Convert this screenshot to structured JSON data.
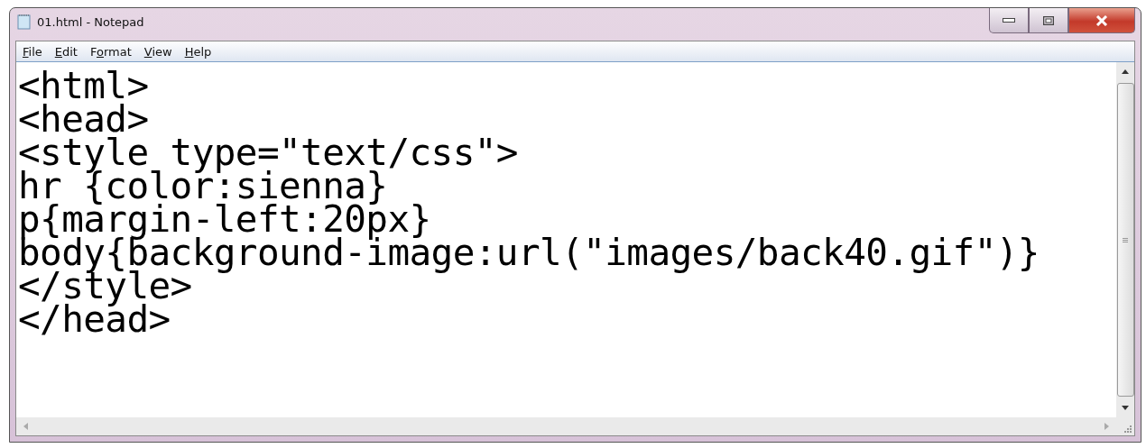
{
  "window": {
    "title": "01.html - Notepad"
  },
  "menu": [
    {
      "key": "F",
      "post": "ile"
    },
    {
      "key": "E",
      "post": "dit"
    },
    {
      "pre": "F",
      "key": "o",
      "post": "rmat"
    },
    {
      "key": "V",
      "post": "iew"
    },
    {
      "key": "H",
      "post": "elp"
    }
  ],
  "editor": {
    "lines": [
      "<html>",
      "<head>",
      "<style type=\"text/css\">",
      "hr {color:sienna}",
      "p{margin-left:20px}",
      "body{background-image:url(\"images/back40.gif\")}",
      "</style>",
      "</head>"
    ]
  }
}
